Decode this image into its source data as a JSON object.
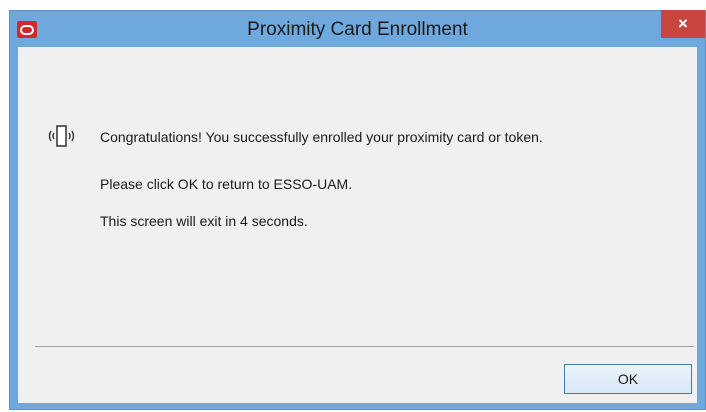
{
  "window": {
    "title": "Proximity Card Enrollment",
    "close_label": "×"
  },
  "content": {
    "message": "Congratulations! You successfully enrolled your proximity card or token.",
    "instruction": "Please click OK to return to ESSO-UAM.",
    "countdown": "This screen will exit in 4 seconds."
  },
  "buttons": {
    "ok_label": "OK"
  },
  "icons": {
    "app": "oracle-logo-icon",
    "card": "proximity-card-icon",
    "close": "close-icon"
  },
  "colors": {
    "titlebar": "#6fa8dc",
    "close": "#c7473f",
    "app_icon": "#d6262e",
    "client_bg": "#f0f0f0"
  }
}
